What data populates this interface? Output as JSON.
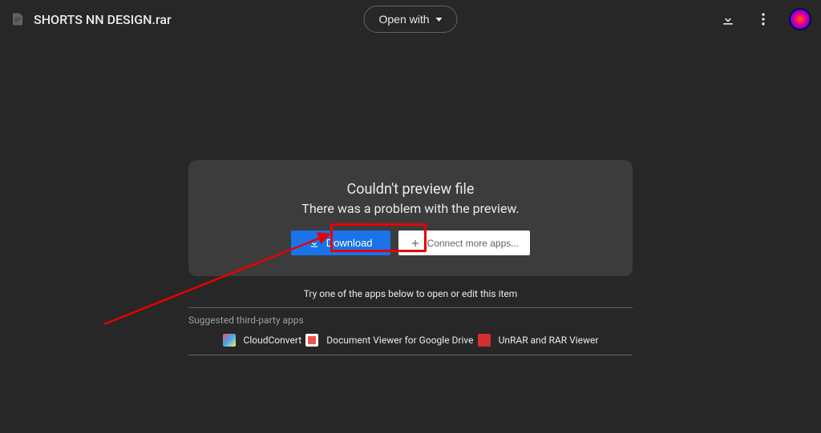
{
  "header": {
    "file_name": "SHORTS NN DESIGN.rar",
    "open_with_label": "Open with"
  },
  "preview": {
    "title": "Couldn't preview file",
    "subtitle": "There was a problem with the preview.",
    "download_label": "Download",
    "connect_label": "Connect more apps..."
  },
  "suggestions": {
    "try_text": "Try one of the apps below to open or edit this item",
    "suggested_label": "Suggested third-party apps",
    "apps": [
      {
        "name": "CloudConvert"
      },
      {
        "name": "Document Viewer for Google Drive"
      },
      {
        "name": "UnRAR and RAR Viewer"
      }
    ]
  }
}
